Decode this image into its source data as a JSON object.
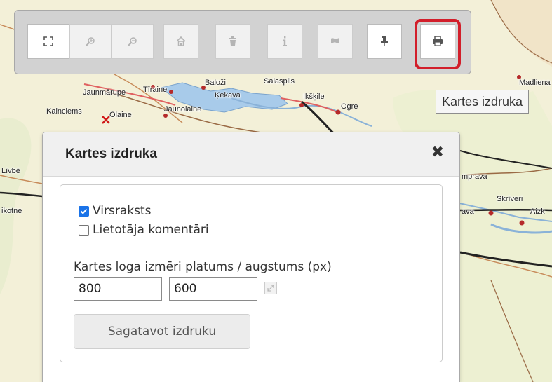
{
  "map": {
    "place_names": [
      "Jaunmārupe",
      "Tīraine",
      "Baloži",
      "Salaspils",
      "Ķekava",
      "Ikšķile",
      "Ogre",
      "Kalnciems",
      "Olaine",
      "Jaunolaine",
      "Līvbē",
      "ikotne",
      "mprava",
      "Skrīveri",
      "ava",
      "Aizk",
      "Madliena"
    ]
  },
  "toolbar": {
    "buttons": [
      {
        "icon": "fullscreen-icon",
        "state": "active"
      },
      {
        "icon": "zoom-in-icon",
        "state": "disabled"
      },
      {
        "icon": "zoom-out-icon",
        "state": "disabled"
      },
      {
        "icon": "home-icon",
        "state": "disabled"
      },
      {
        "icon": "trash-icon",
        "state": "disabled"
      },
      {
        "icon": "info-icon",
        "state": "disabled"
      },
      {
        "icon": "flag-icon",
        "state": "disabled"
      },
      {
        "icon": "pin-icon",
        "state": "active"
      },
      {
        "icon": "print-icon",
        "state": "active",
        "highlighted": true
      }
    ],
    "highlight_color": "#d21e2a"
  },
  "tooltip": {
    "text": "Kartes izdruka"
  },
  "dialog": {
    "title": "Kartes izdruka",
    "close_glyph": "✖",
    "options": [
      {
        "label": "Virsraksts",
        "checked": true
      },
      {
        "label": "Lietotāja komentāri",
        "checked": false
      }
    ],
    "size_label": "Kartes loga izmēri platums / augstums (px)",
    "width_value": "800",
    "height_value": "600",
    "submit_label": "Sagatavot izdruku"
  },
  "colors": {
    "accent_checkbox": "#1a73e8",
    "map_background": "#f3f0d8"
  }
}
